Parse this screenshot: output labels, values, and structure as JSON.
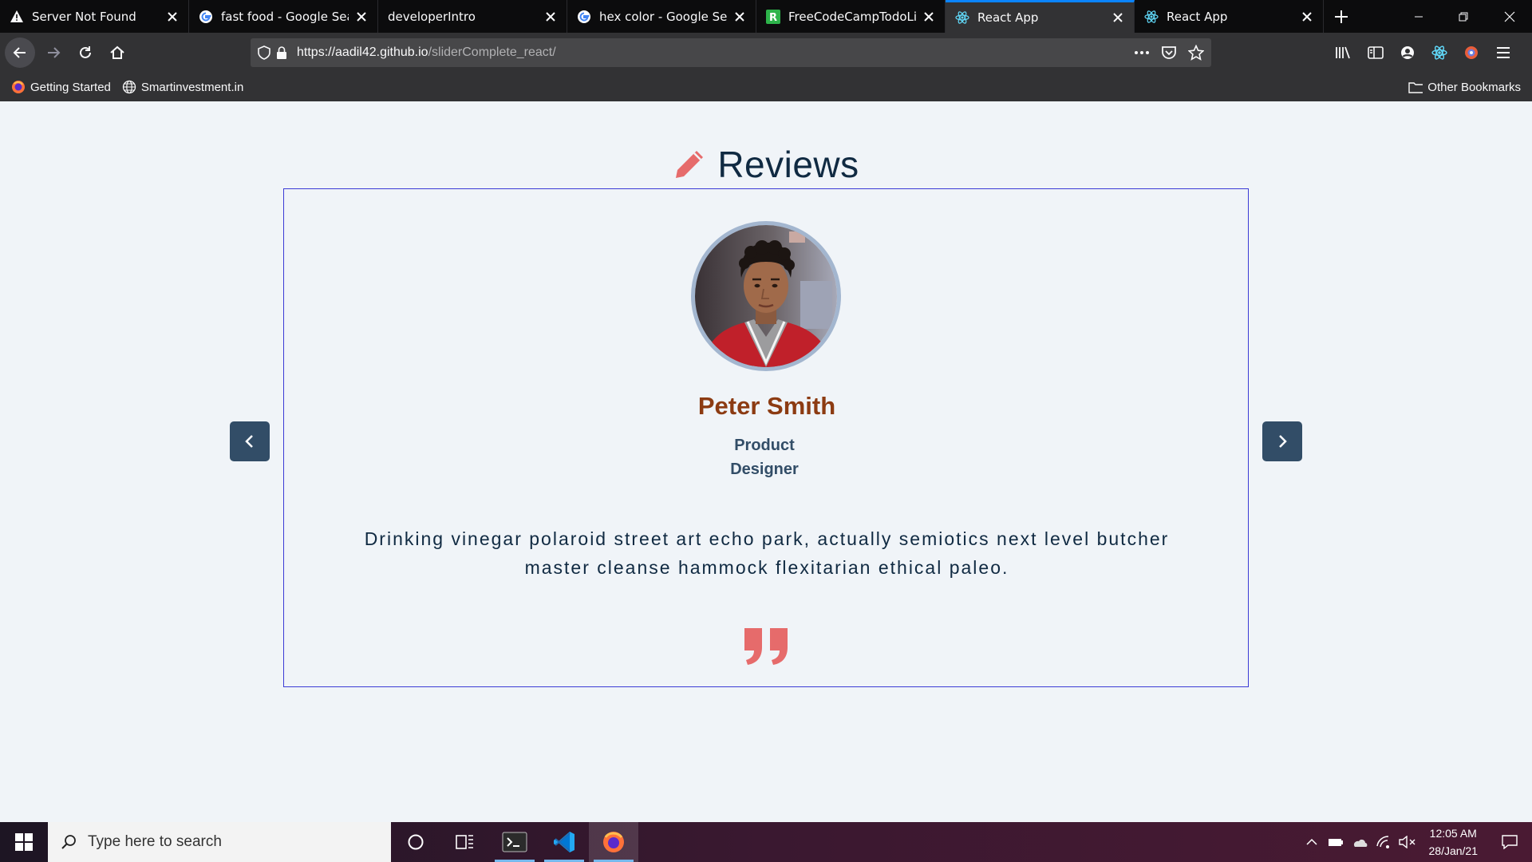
{
  "browser": {
    "tabs": [
      {
        "title": "Server Not Found",
        "icon": "warning-icon"
      },
      {
        "title": "fast food - Google Search",
        "icon": "google-icon"
      },
      {
        "title": "developerIntro",
        "icon": "none"
      },
      {
        "title": "hex color - Google Search",
        "icon": "google-icon"
      },
      {
        "title": "FreeCodeCampTodoList",
        "icon": "replit-icon"
      },
      {
        "title": "React App",
        "icon": "react-icon"
      },
      {
        "title": "React App",
        "icon": "react-icon"
      }
    ],
    "active_tab_index": 5,
    "url_host": "https://aadil42.github.io",
    "url_path": "/sliderComplete_react/",
    "bookmarks": [
      {
        "label": "Getting Started",
        "icon": "firefox-icon"
      },
      {
        "label": "Smartinvestment.in",
        "icon": "globe-icon"
      }
    ],
    "other_bookmarks_label": "Other Bookmarks",
    "accent": "#0a84ff"
  },
  "page": {
    "heading": "Reviews",
    "review": {
      "name": "Peter Smith",
      "job_line1": "Product",
      "job_line2": "Designer",
      "text": "Drinking vinegar polaroid street art echo park, actually semiotics next level butcher master cleanse hammock flexitarian ethical paleo."
    },
    "colors": {
      "name": "#8c3b12",
      "icon": "#e66b6b",
      "button": "#324d67",
      "border": "#3b3bd6",
      "background": "#f0f4f8"
    }
  },
  "taskbar": {
    "search_placeholder": "Type here to search",
    "time": "12:05 AM",
    "date": "28/Jan/21"
  }
}
